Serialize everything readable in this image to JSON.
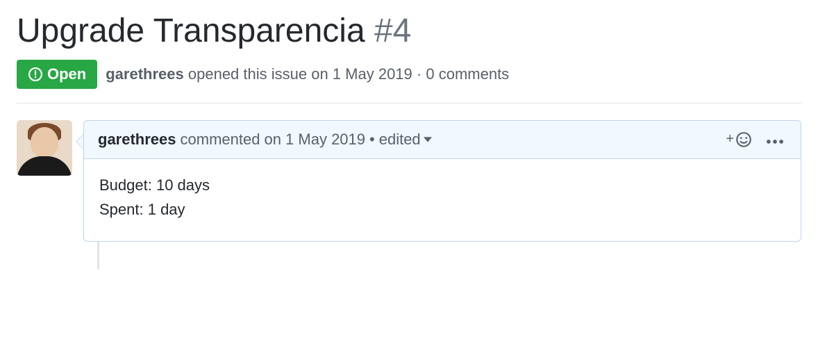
{
  "issue": {
    "title": "Upgrade Transparencia",
    "number": "#4",
    "state_label": "Open",
    "author": "garethrees",
    "opened_verb": "opened this issue",
    "opened_date": "on 1 May 2019",
    "comment_count": "0 comments"
  },
  "comment": {
    "author": "garethrees",
    "action": "commented",
    "date": "on 1 May 2019",
    "edited_label": "edited",
    "body_lines": {
      "0": "Budget: 10 days",
      "1": "Spent: 1 day"
    }
  }
}
